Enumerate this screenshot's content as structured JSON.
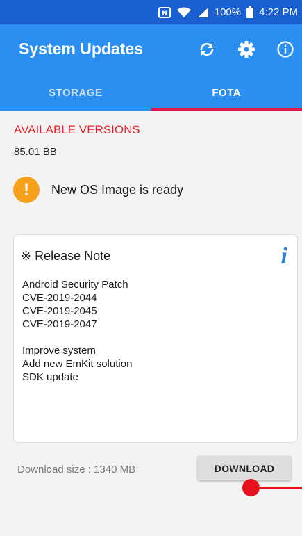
{
  "status_bar": {
    "battery": "100%",
    "time": "4:22 PM",
    "icons": [
      "nfc-icon",
      "wifi-icon",
      "cell-signal-icon",
      "battery-icon"
    ]
  },
  "app_bar": {
    "title": "System Updates",
    "icons": [
      "refresh-icon",
      "settings-icon",
      "info-icon"
    ]
  },
  "tabs": [
    {
      "label": "STORAGE",
      "active": false
    },
    {
      "label": "FOTA",
      "active": true
    }
  ],
  "content": {
    "available_label": "AVAILABLE VERSIONS",
    "version": "85.01 BB",
    "notice_icon_glyph": "!",
    "notice_text": "New OS Image is ready",
    "release_note": {
      "title": "※ Release Note",
      "info_glyph": "i",
      "lines": [
        "Android Security Patch",
        "CVE-2019-2044",
        "CVE-2019-2045",
        "CVE-2019-2047",
        "",
        "Improve system",
        "Add new EmKit solution",
        "SDK update"
      ]
    },
    "download_size": "Download size : 1340 MB",
    "download_label": "DOWNLOAD"
  },
  "colors": {
    "status_bar": "#1a5fd0",
    "app_bar": "#2a8ff1",
    "tab_indicator": "#e8134a",
    "available_label": "#e81f28",
    "notice_icon": "#f5a11c",
    "info_glyph": "#2a7fd4",
    "tap_indicator": "#e8121c"
  }
}
